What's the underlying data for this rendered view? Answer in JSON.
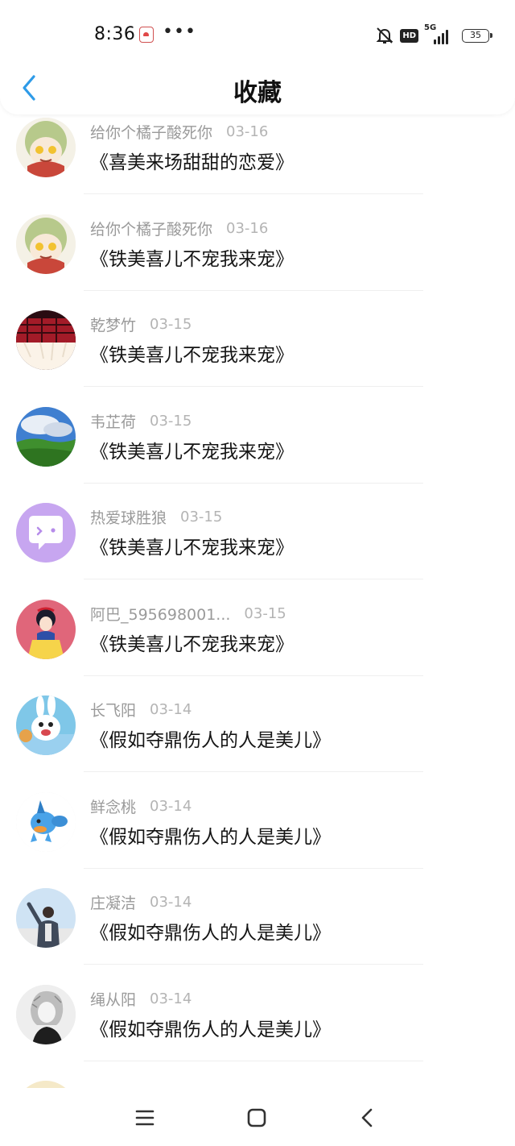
{
  "status_bar": {
    "time": "8:36",
    "more": "•••",
    "hd": "HD",
    "network": "5G",
    "battery": "35"
  },
  "header": {
    "title": "收藏"
  },
  "favorites": [
    {
      "user": "给你个橘子酸死你",
      "date": "03-16",
      "title": "《喜美来场甜甜的恋爱》",
      "avatar": "anime-girl-avatar"
    },
    {
      "user": "给你个橘子酸死你",
      "date": "03-16",
      "title": "《铁美喜儿不宠我来宠》",
      "avatar": "anime-girl-avatar"
    },
    {
      "user": "乾梦竹",
      "date": "03-15",
      "title": "《铁美喜儿不宠我来宠》",
      "avatar": "plaid-skirt-avatar"
    },
    {
      "user": "韦芷荷",
      "date": "03-15",
      "title": "《铁美喜儿不宠我来宠》",
      "avatar": "landscape-sky-avatar"
    },
    {
      "user": "热爱球胜狼",
      "date": "03-15",
      "title": "《铁美喜儿不宠我来宠》",
      "avatar": "chat-bubble-avatar"
    },
    {
      "user": "阿巴_595698001...",
      "date": "03-15",
      "title": "《铁美喜儿不宠我来宠》",
      "avatar": "snow-white-avatar"
    },
    {
      "user": "长飞阳",
      "date": "03-14",
      "title": "《假如夺鼎伤人的人是美儿》",
      "avatar": "rabbid-avatar"
    },
    {
      "user": "鲜念桃",
      "date": "03-14",
      "title": "《假如夺鼎伤人的人是美儿》",
      "avatar": "mudkip-avatar"
    },
    {
      "user": "庄凝洁",
      "date": "03-14",
      "title": "《假如夺鼎伤人的人是美儿》",
      "avatar": "person-photo-avatar"
    },
    {
      "user": "绳从阳",
      "date": "03-14",
      "title": "《假如夺鼎伤人的人是美儿》",
      "avatar": "sketch-portrait-avatar"
    }
  ],
  "colors": {
    "accent": "#2e9be8",
    "username": "#9a9a9a",
    "date": "#b4b4b4",
    "title": "#151515"
  }
}
